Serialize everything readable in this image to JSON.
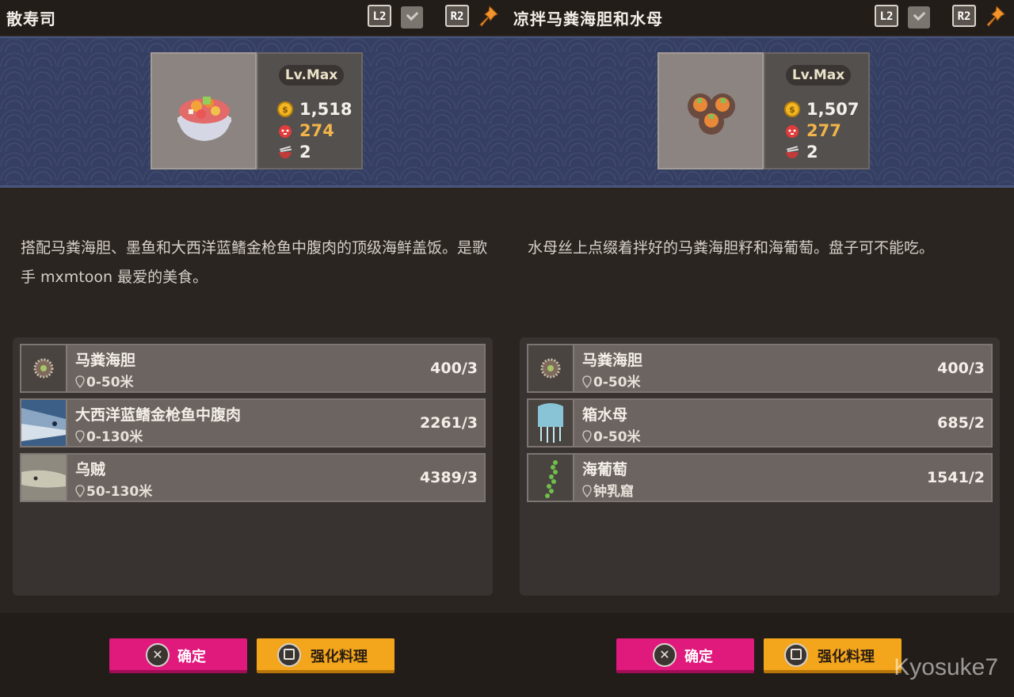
{
  "buttons": {
    "l2": "L2",
    "r2": "R2",
    "confirm": "确定",
    "enhance": "强化料理"
  },
  "icons": {
    "confirm_button": "cross-circle-icon",
    "enhance_button": "square-circle-icon",
    "gold": "coin-icon",
    "taste": "flame-face-icon",
    "servings": "bowl-icon",
    "location": "location-pin-icon",
    "pin": "pushpin-icon"
  },
  "colors": {
    "confirm": "#e0197d",
    "enhance": "#f3a51c",
    "banner": "#353f63",
    "taste_value": "#f1b44a"
  },
  "left": {
    "title": "散寿司",
    "level": "Lv.Max",
    "gold": "1,518",
    "taste": "274",
    "servings": "2",
    "description": "搭配马粪海胆、墨鱼和大西洋蓝鳍金枪鱼中腹肉的顶级海鲜盖饭。是歌手 mxmtoon 最爱的美食。",
    "ingredients": [
      {
        "name": "马粪海胆",
        "location": "0-50米",
        "count": "400/3"
      },
      {
        "name": "大西洋蓝鳍金枪鱼中腹肉",
        "location": "0-130米",
        "count": "2261/3"
      },
      {
        "name": "乌贼",
        "location": "50-130米",
        "count": "4389/3"
      }
    ]
  },
  "right": {
    "title": "凉拌马粪海胆和水母",
    "level": "Lv.Max",
    "gold": "1,507",
    "taste": "277",
    "servings": "2",
    "description": "水母丝上点缀着拌好的马粪海胆籽和海葡萄。盘子可不能吃。",
    "ingredients": [
      {
        "name": "马粪海胆",
        "location": "0-50米",
        "count": "400/3"
      },
      {
        "name": "箱水母",
        "location": "0-50米",
        "count": "685/2"
      },
      {
        "name": "海葡萄",
        "location": "钟乳窟",
        "count": "1541/2"
      }
    ]
  },
  "watermark": "Kyosuke7"
}
